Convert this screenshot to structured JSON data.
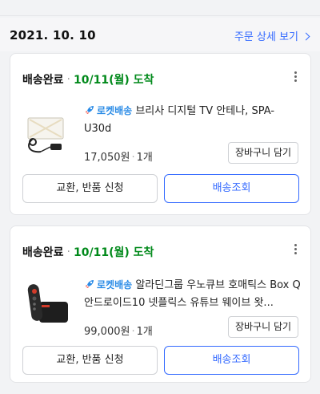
{
  "date_header": {
    "date": "2021. 10. 10",
    "detail_link": "주문 상세 보기"
  },
  "orders": [
    {
      "status": "배송완료",
      "dot": "·",
      "arrival": "10/11(월) 도착",
      "badge": "로켓배송",
      "product": "브리사 디지털 TV 안테나, SPA-U30d",
      "price": "17,050원",
      "qty": "1개",
      "cart_label": "장바구니 담기",
      "exchange_label": "교환, 반품 신청",
      "track_label": "배송조회"
    },
    {
      "status": "배송완료",
      "dot": "·",
      "arrival": "10/11(월) 도착",
      "badge": "로켓배송",
      "product": "알라딘그룹 우노큐브 호매틱스 Box Q 안드로이드10 넷플릭스 유튜브 웨이브 왓...",
      "price": "99,000원",
      "qty": "1개",
      "cart_label": "장바구니 담기",
      "exchange_label": "교환, 반품 신청",
      "track_label": "배송조회"
    }
  ],
  "colors": {
    "accent": "#346aff",
    "arrival": "#00891a",
    "rocket": "#2a8be6"
  }
}
